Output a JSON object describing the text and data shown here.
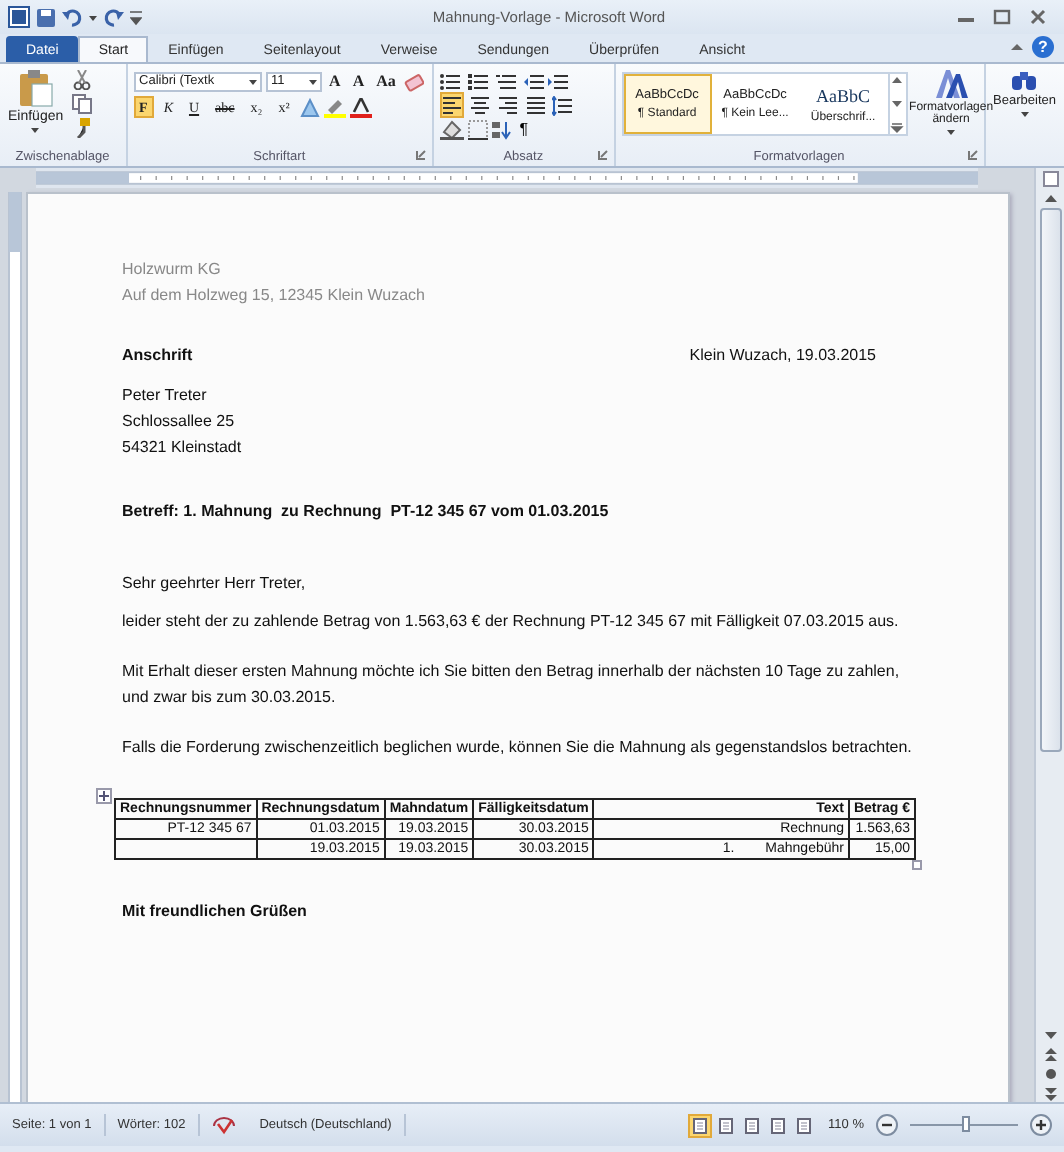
{
  "window": {
    "title": "Mahnung-Vorlage - Microsoft Word"
  },
  "tabs": [
    {
      "label": "Datei",
      "kind": "file",
      "selected": false
    },
    {
      "label": "Start",
      "kind": "tab",
      "selected": true
    },
    {
      "label": "Einfügen",
      "kind": "tab",
      "selected": false
    },
    {
      "label": "Seitenlayout",
      "kind": "tab",
      "selected": false
    },
    {
      "label": "Verweise",
      "kind": "tab",
      "selected": false
    },
    {
      "label": "Sendungen",
      "kind": "tab",
      "selected": false
    },
    {
      "label": "Überprüfen",
      "kind": "tab",
      "selected": false
    },
    {
      "label": "Ansicht",
      "kind": "tab",
      "selected": false
    }
  ],
  "help": "?",
  "ribbon": {
    "clipboard": {
      "label": "Zwischenablage",
      "paste": "Einfügen"
    },
    "font": {
      "label": "Schriftart",
      "name": "Calibri (Textk",
      "size": "11",
      "tools": [
        "A",
        "A",
        "Aa"
      ],
      "formats": [
        {
          "label": "F",
          "selected": true
        },
        {
          "label": "K",
          "selected": false
        },
        {
          "label": "U",
          "selected": false
        },
        {
          "label": "abc",
          "selected": false
        },
        {
          "label": "x₂",
          "selected": false
        },
        {
          "label": "x²",
          "selected": false
        }
      ]
    },
    "paragraph": {
      "label": "Absatz",
      "alignments": [
        {
          "selected": true
        },
        {
          "selected": false
        },
        {
          "selected": false
        },
        {
          "selected": false
        }
      ],
      "marks": "¶"
    },
    "styles": {
      "label": "Formatvorlagen",
      "items": [
        {
          "preview": "AaBbCcDc",
          "label": "¶ Standard",
          "kind": "body",
          "selected": true
        },
        {
          "preview": "AaBbCcDc",
          "label": "¶ Kein Lee...",
          "kind": "body",
          "selected": false
        },
        {
          "preview": "AaBbC",
          "label": "Überschrif...",
          "kind": "heading",
          "selected": false
        }
      ],
      "change": "Formatvorlagen ändern"
    },
    "editing": {
      "label": "Bearbeiten"
    }
  },
  "document": {
    "sender": [
      "Holzwurm KG",
      "Auf dem Holzweg 15, 12345 Klein Wuzach"
    ],
    "address_heading": "Anschrift",
    "place_date": "Klein Wuzach, 19.03.2015",
    "recipient": [
      "Peter Treter",
      "Schlossallee 25",
      "54321 Kleinstadt"
    ],
    "subject": "Betreff: 1. Mahnung  zu Rechnung  PT-12 345 67 vom 01.03.2015",
    "salutation": "Sehr geehrter Herr Treter,",
    "paragraphs": [
      "leider steht der zu zahlende Betrag von 1.563,63  € der Rechnung PT-12 345 67 mit Fälligkeit 07.03.2015 aus.",
      "Mit Erhalt dieser ersten Mahnung möchte ich Sie bitten den Betrag innerhalb der nächsten 10 Tage zu zahlen, und zwar bis zum 30.03.2015.",
      "Falls die Forderung zwischenzeitlich beglichen wurde, können Sie die Mahnung als gegenstandslos betrachten."
    ],
    "table": {
      "columns": [
        "Rechnungsnummer",
        "Rechnungsdatum",
        "Mahndatum",
        "Fälligkeitsdatum",
        "Text",
        "Betrag €"
      ],
      "rows": [
        {
          "cells": [
            "PT-12 345 67",
            "01.03.2015",
            "19.03.2015",
            "30.03.2015",
            "Rechnung",
            "1.563,63"
          ]
        },
        {
          "cells": [
            null,
            "19.03.2015",
            "19.03.2015",
            "30.03.2015",
            "Mahngebühr",
            "15,00"
          ],
          "list_number": "1."
        }
      ]
    },
    "closing": "Mit freundlichen Grüßen"
  },
  "status_bar": {
    "page": "Seite: 1 von 1",
    "words": "Wörter: 102",
    "language": "Deutsch (Deutschland)",
    "view_buttons": [
      {
        "selected": true
      },
      {
        "selected": false
      },
      {
        "selected": false
      },
      {
        "selected": false
      },
      {
        "selected": false
      }
    ],
    "zoom": "110 %",
    "zoom_slider": {
      "level": 0.52
    }
  }
}
